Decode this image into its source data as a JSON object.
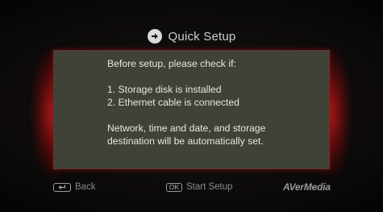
{
  "header": {
    "icon": "arrow-right-circle-icon",
    "title": "Quick Setup"
  },
  "panel": {
    "lines": [
      "Before setup, please check if:",
      "",
      "1. Storage disk is installed",
      "2. Ethernet cable is connected",
      "",
      "Network, time and date, and storage",
      "destination will be automatically set."
    ]
  },
  "footer": {
    "back_key": "return-key-icon",
    "back_label": "Back",
    "start_key": "OK",
    "start_label": "Start Setup",
    "brand": "AVerMedia"
  },
  "colors": {
    "panel_bg": "#3f4337",
    "accent_glow": "#c81e1e",
    "text": "#e6e6e6"
  }
}
